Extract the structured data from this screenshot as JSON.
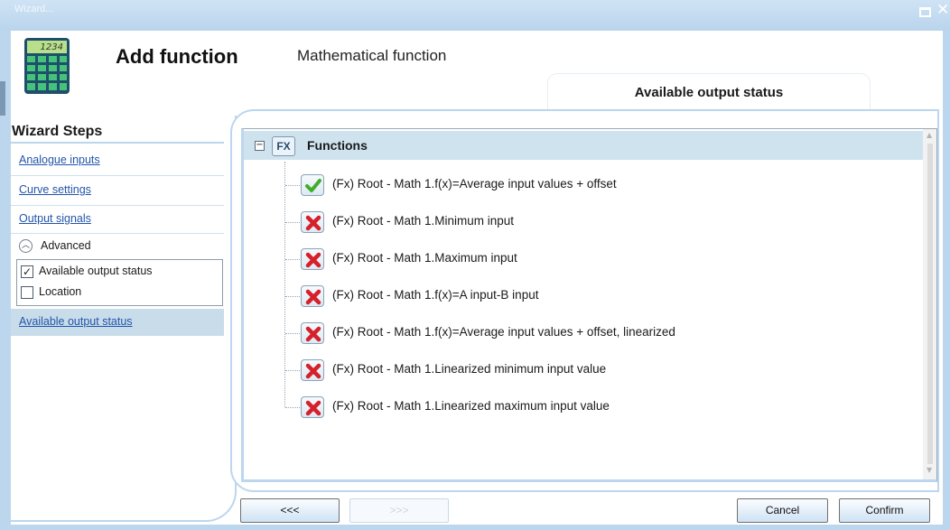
{
  "window": {
    "title": "Wizard...",
    "maximize_glyph": "",
    "close_glyph": "✕"
  },
  "header": {
    "title": "Add function",
    "subtitle": "Mathematical function",
    "icon": "calculator-icon",
    "calculator_display": "1234"
  },
  "tab": {
    "label": "Available output status"
  },
  "sidebar": {
    "title": "Wizard Steps",
    "steps": [
      {
        "label": "Analogue inputs"
      },
      {
        "label": "Curve settings"
      },
      {
        "label": "Output signals"
      }
    ],
    "advanced": {
      "label": "Advanced",
      "options": [
        {
          "label": "Available output status",
          "checked": true
        },
        {
          "label": "Location",
          "checked": false
        }
      ]
    },
    "active_step": {
      "label": "Available output status"
    }
  },
  "tree": {
    "root_label": "Functions",
    "root_icon_text": "FX",
    "collapse_glyph": "−",
    "items": [
      {
        "label": "(Fx) Root - Math 1.f(x)=Average input values + offset",
        "status": "enabled",
        "icon": "check-icon"
      },
      {
        "label": "(Fx) Root - Math 1.Minimum input",
        "status": "disabled",
        "icon": "x-icon"
      },
      {
        "label": "(Fx) Root - Math 1.Maximum input",
        "status": "disabled",
        "icon": "x-icon"
      },
      {
        "label": "(Fx) Root - Math 1.f(x)=A input-B input",
        "status": "disabled",
        "icon": "x-icon"
      },
      {
        "label": "(Fx) Root - Math 1.f(x)=Average input values + offset, linearized",
        "status": "disabled",
        "icon": "x-icon"
      },
      {
        "label": "(Fx) Root - Math 1.Linearized minimum input value",
        "status": "disabled",
        "icon": "x-icon"
      },
      {
        "label": "(Fx) Root - Math 1.Linearized maximum input value",
        "status": "disabled",
        "icon": "x-icon"
      }
    ]
  },
  "buttons": {
    "back": "<<<",
    "next": ">>>",
    "cancel": "Cancel",
    "confirm": "Confirm"
  },
  "colors": {
    "accent": "#bcd6ee",
    "link": "#2255aa",
    "check": "#3fae2a",
    "cross": "#d6202a"
  }
}
